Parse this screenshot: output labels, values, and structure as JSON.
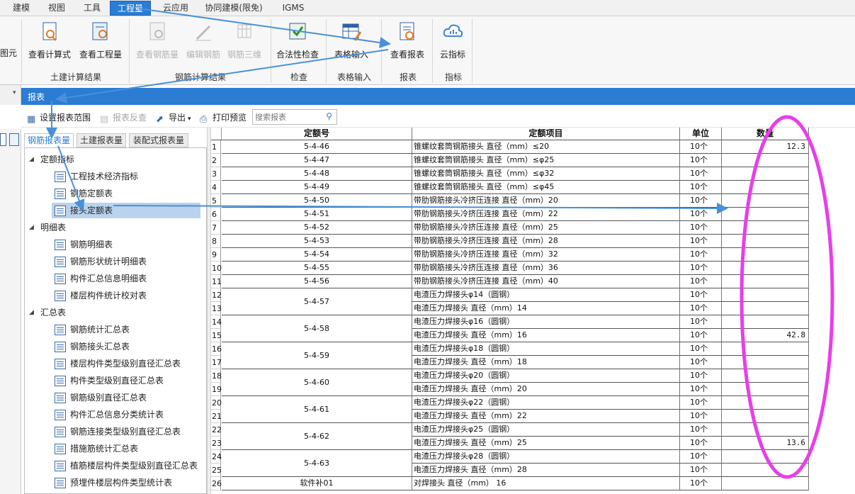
{
  "menu": [
    {
      "label": "建模",
      "active": false
    },
    {
      "label": "视图",
      "active": false
    },
    {
      "label": "工具",
      "active": false
    },
    {
      "label": "工程量",
      "active": true
    },
    {
      "label": "云应用",
      "active": false
    },
    {
      "label": "协同建模(限免)",
      "active": false
    },
    {
      "label": "IGMS",
      "active": false
    }
  ],
  "ribbon": {
    "cut_label": "图元",
    "buttons": [
      {
        "label": "查看计算式",
        "icon": "formula-view-icon",
        "disabled": false
      },
      {
        "label": "查看工程量",
        "icon": "quantity-view-icon",
        "disabled": false
      },
      {
        "label": "查看钢筋量",
        "icon": "rebar-quantity-icon",
        "disabled": true
      },
      {
        "label": "编辑钢筋",
        "icon": "rebar-edit-icon",
        "disabled": true
      },
      {
        "label": "钢筋三维",
        "icon": "rebar-3d-icon",
        "disabled": true
      },
      {
        "label": "合法性检查",
        "icon": "validity-check-icon",
        "disabled": false
      },
      {
        "label": "表格输入",
        "icon": "table-input-icon",
        "disabled": false
      },
      {
        "label": "查看报表",
        "icon": "report-view-icon",
        "disabled": false
      },
      {
        "label": "云指标",
        "icon": "cloud-index-icon",
        "disabled": false
      }
    ],
    "groups": [
      "土建计算结果",
      "钢筋计算结果",
      "检查",
      "表格输入",
      "报表",
      "指标"
    ]
  },
  "report_panel": {
    "title": "报表",
    "toolbar": [
      {
        "label": "设置报表范围",
        "icon": "report-range-icon",
        "disabled": false
      },
      {
        "label": "报表反查",
        "icon": "report-lookup-icon",
        "disabled": true
      },
      {
        "label": "导出",
        "icon": "export-icon",
        "disabled": false
      },
      {
        "label": "打印预览",
        "icon": "print-preview-icon",
        "disabled": false
      }
    ],
    "search_placeholder": "搜索报表",
    "tabs": [
      {
        "label": "钢筋报表量",
        "active": true
      },
      {
        "label": "土建报表量",
        "active": false
      },
      {
        "label": "装配式报表量",
        "active": false
      }
    ],
    "tree": [
      {
        "label": "定额指标",
        "type": "group",
        "expanded": true
      },
      {
        "label": "工程技术经济指标",
        "type": "report",
        "selected": false
      },
      {
        "label": "钢筋定额表",
        "type": "report",
        "selected": false
      },
      {
        "label": "接头定额表",
        "type": "report",
        "selected": true
      },
      {
        "label": "明细表",
        "type": "group",
        "expanded": true
      },
      {
        "label": "钢筋明细表",
        "type": "report",
        "selected": false
      },
      {
        "label": "钢筋形状统计明细表",
        "type": "report",
        "selected": false
      },
      {
        "label": "构件汇总信息明细表",
        "type": "report",
        "selected": false
      },
      {
        "label": "楼层构件统计校对表",
        "type": "report",
        "selected": false
      },
      {
        "label": "汇总表",
        "type": "group",
        "expanded": true
      },
      {
        "label": "钢筋统计汇总表",
        "type": "report",
        "selected": false
      },
      {
        "label": "钢筋接头汇总表",
        "type": "report",
        "selected": false
      },
      {
        "label": "楼层构件类型级别直径汇总表",
        "type": "report",
        "selected": false
      },
      {
        "label": "构件类型级别直径汇总表",
        "type": "report",
        "selected": false
      },
      {
        "label": "钢筋级别直径汇总表",
        "type": "report",
        "selected": false
      },
      {
        "label": "构件汇总信息分类统计表",
        "type": "report",
        "selected": false
      },
      {
        "label": "钢筋连接类型级别直径汇总表",
        "type": "report",
        "selected": false
      },
      {
        "label": "措施筋统计汇总表",
        "type": "report",
        "selected": false
      },
      {
        "label": "植筋楼层构件类型级别直径汇总表",
        "type": "report",
        "selected": false
      },
      {
        "label": "预埋件楼层构件类型统计表",
        "type": "report",
        "selected": false
      }
    ]
  },
  "table": {
    "headers": [
      "定额号",
      "定额项目",
      "单位",
      "数量"
    ],
    "groups": [
      {
        "code": "5-4-46",
        "rows": [
          {
            "n": "1",
            "item": "锥螺纹套筒钢筋接头 直径（mm）≤20",
            "unit": "10个",
            "qty": "12.3"
          }
        ]
      },
      {
        "code": "5-4-47",
        "rows": [
          {
            "n": "2",
            "item": "锥螺纹套筒钢筋接头 直径（mm）≤φ25",
            "unit": "10个",
            "qty": ""
          }
        ]
      },
      {
        "code": "5-4-48",
        "rows": [
          {
            "n": "3",
            "item": "锥螺纹套筒钢筋接头 直径（mm）≤φ32",
            "unit": "10个",
            "qty": ""
          }
        ]
      },
      {
        "code": "5-4-49",
        "rows": [
          {
            "n": "4",
            "item": "锥螺纹套筒钢筋接头 直径（mm）≤φ45",
            "unit": "10个",
            "qty": ""
          }
        ]
      },
      {
        "code": "5-4-50",
        "rows": [
          {
            "n": "5",
            "item": "带肋钢筋接头冷挤压连接 直径（mm）20",
            "unit": "10个",
            "qty": ""
          }
        ]
      },
      {
        "code": "5-4-51",
        "rows": [
          {
            "n": "6",
            "item": "带肋钢筋接头冷挤压连接 直径（mm）22",
            "unit": "10个",
            "qty": ""
          }
        ]
      },
      {
        "code": "5-4-52",
        "rows": [
          {
            "n": "7",
            "item": "带肋钢筋接头冷挤压连接 直径（mm）25",
            "unit": "10个",
            "qty": ""
          }
        ]
      },
      {
        "code": "5-4-53",
        "rows": [
          {
            "n": "8",
            "item": "带肋钢筋接头冷挤压连接 直径（mm）28",
            "unit": "10个",
            "qty": ""
          }
        ]
      },
      {
        "code": "5-4-54",
        "rows": [
          {
            "n": "9",
            "item": "带肋钢筋接头冷挤压连接 直径（mm）32",
            "unit": "10个",
            "qty": ""
          }
        ]
      },
      {
        "code": "5-4-55",
        "rows": [
          {
            "n": "10",
            "item": "带肋钢筋接头冷挤压连接 直径（mm）36",
            "unit": "10个",
            "qty": ""
          }
        ]
      },
      {
        "code": "5-4-56",
        "rows": [
          {
            "n": "11",
            "item": "带肋钢筋接头冷挤压连接 直径（mm）40",
            "unit": "10个",
            "qty": ""
          }
        ]
      },
      {
        "code": "5-4-57",
        "rows": [
          {
            "n": "12",
            "item": "电渣压力焊接头φ14（圆钢）",
            "unit": "10个",
            "qty": ""
          },
          {
            "n": "13",
            "item": "电渣压力焊接头 直径（mm）14",
            "unit": "10个",
            "qty": ""
          }
        ]
      },
      {
        "code": "5-4-58",
        "rows": [
          {
            "n": "14",
            "item": "电渣压力焊接头φ16（圆钢）",
            "unit": "10个",
            "qty": ""
          },
          {
            "n": "15",
            "item": "电渣压力焊接头 直径（mm）16",
            "unit": "10个",
            "qty": "42.8"
          }
        ]
      },
      {
        "code": "5-4-59",
        "rows": [
          {
            "n": "16",
            "item": "电渣压力焊接头φ18（圆钢）",
            "unit": "10个",
            "qty": ""
          },
          {
            "n": "17",
            "item": "电渣压力焊接头 直径（mm）18",
            "unit": "10个",
            "qty": ""
          }
        ]
      },
      {
        "code": "5-4-60",
        "rows": [
          {
            "n": "18",
            "item": "电渣压力焊接头φ20（圆钢）",
            "unit": "10个",
            "qty": ""
          },
          {
            "n": "19",
            "item": "电渣压力焊接头 直径（mm）20",
            "unit": "10个",
            "qty": ""
          }
        ]
      },
      {
        "code": "5-4-61",
        "rows": [
          {
            "n": "20",
            "item": "电渣压力焊接头φ22（圆钢）",
            "unit": "10个",
            "qty": ""
          },
          {
            "n": "21",
            "item": "电渣压力焊接头 直径（mm）22",
            "unit": "10个",
            "qty": ""
          }
        ]
      },
      {
        "code": "5-4-62",
        "rows": [
          {
            "n": "22",
            "item": "电渣压力焊接头φ25（圆钢）",
            "unit": "10个",
            "qty": ""
          },
          {
            "n": "23",
            "item": "电渣压力焊接头 直径（mm）25",
            "unit": "10个",
            "qty": "13.6"
          }
        ]
      },
      {
        "code": "5-4-63",
        "rows": [
          {
            "n": "24",
            "item": "电渣压力焊接头φ28（圆钢）",
            "unit": "10个",
            "qty": ""
          },
          {
            "n": "25",
            "item": "电渣压力焊接头 直径（mm）28",
            "unit": "10个",
            "qty": ""
          }
        ]
      },
      {
        "code": "软件补01",
        "rows": [
          {
            "n": "26",
            "item": "对焊接头 直径（mm） 16",
            "unit": "10个",
            "qty": ""
          }
        ]
      }
    ]
  },
  "annotation": {
    "arrow_color": "#4a90d9",
    "ellipse_color": "#e83ee8"
  },
  "colors": {
    "accent": "#2b7cd3",
    "selection": "#b9d3ee"
  }
}
